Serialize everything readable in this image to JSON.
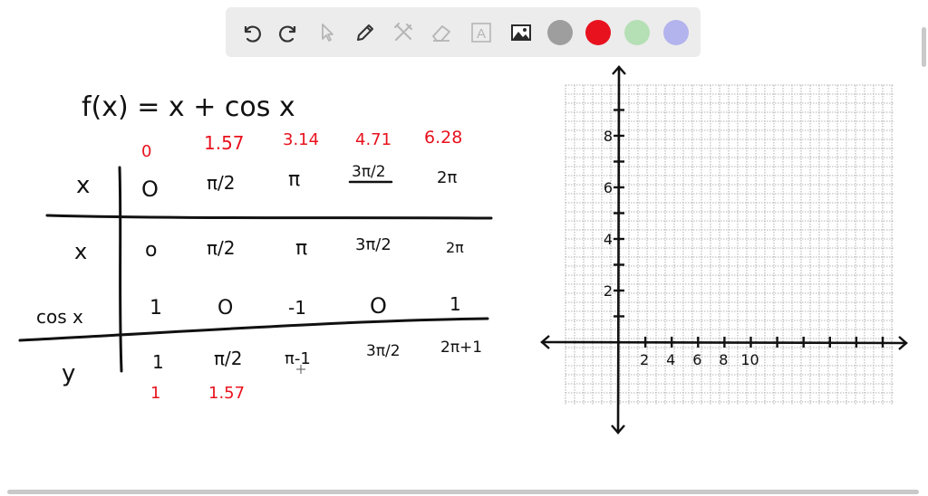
{
  "toolbar": {
    "tools": [
      {
        "name": "undo-icon"
      },
      {
        "name": "redo-icon"
      },
      {
        "name": "pointer-icon"
      },
      {
        "name": "pen-icon"
      },
      {
        "name": "tools-icon"
      },
      {
        "name": "eraser-icon"
      },
      {
        "name": "text-icon",
        "glyph": "A"
      },
      {
        "name": "image-icon"
      }
    ],
    "colors": [
      "#9e9e9e",
      "#e8121e",
      "#b5dfb5",
      "#b3b3ee"
    ]
  },
  "board": {
    "equation": "f(x) = x + cos x",
    "top_values": [
      "0",
      "1.57",
      "3.14",
      "4.71",
      "6.28"
    ],
    "table": {
      "header_label": "x",
      "header": [
        "O",
        "π/2",
        "π",
        "3π/2",
        "2π"
      ],
      "rows": [
        {
          "label": "x",
          "cells": [
            "o",
            "π/2",
            "π",
            "3π/2",
            "2π"
          ]
        },
        {
          "label": "cos x",
          "cells": [
            "1",
            "O",
            "-1",
            "O",
            "1"
          ]
        },
        {
          "label": "y",
          "cells": [
            "1",
            "π/2",
            "π-1",
            "3π/2",
            "2π+1"
          ]
        }
      ]
    },
    "bottom_values": [
      "1",
      "1.57"
    ],
    "graph": {
      "x_ticks": [
        "2",
        "4",
        "6",
        "8",
        "10"
      ],
      "y_ticks": [
        "8",
        "6",
        "4",
        "2"
      ]
    }
  }
}
